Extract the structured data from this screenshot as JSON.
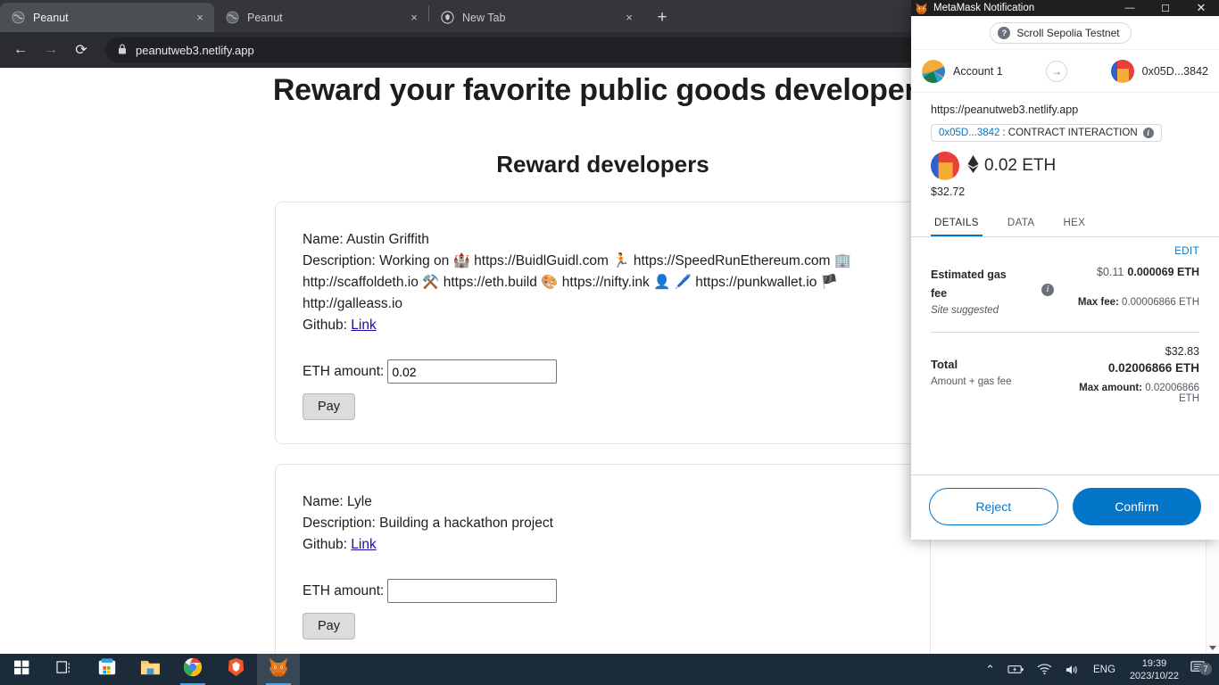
{
  "browser": {
    "tabs": [
      {
        "title": "Peanut",
        "favicon": "peanut-globe-icon",
        "active": true,
        "close_label": "×"
      },
      {
        "title": "Peanut",
        "favicon": "peanut-globe-icon",
        "active": false,
        "close_label": "×"
      },
      {
        "title": "New Tab",
        "favicon": "brave-icon",
        "active": false,
        "close_label": "×"
      }
    ],
    "new_tab_label": "+",
    "back_label": "←",
    "forward_label": "→",
    "reload_label": "⟳",
    "lock_label": "🔒",
    "url": "peanutweb3.netlify.app"
  },
  "page": {
    "heading": "Reward your favorite public goods developers",
    "subheading": "Reward developers",
    "cards": [
      {
        "name_line": "Name: Austin Griffith",
        "description_line": "Description: Working on 🏰 https://BuidlGuidl.com 🏃 https://SpeedRunEthereum.com 🏢 http://scaffoldeth.io ⚒️ https://eth.build 🎨 https://nifty.ink 👤 🖊️ https://punkwallet.io 🏴 http://galleass.io",
        "github_label": "Github:",
        "github_link_text": "Link",
        "eth_amount_label": "ETH amount:",
        "eth_amount_value": "0.02",
        "pay_label": "Pay"
      },
      {
        "name_line": "Name: Lyle",
        "description_line": "Description: Building a hackathon project",
        "github_label": "Github:",
        "github_link_text": "Link",
        "eth_amount_label": "ETH amount:",
        "eth_amount_value": "",
        "pay_label": "Pay"
      }
    ]
  },
  "metamask": {
    "window_title": "MetaMask Notification",
    "minimize_label": "—",
    "maximize_label": "☐",
    "close_label": "✕",
    "network": "Scroll Sepolia Testnet",
    "network_help_label": "?",
    "from_account": "Account 1",
    "to_account": "0x05D...3842",
    "transfer_arrow_label": "→",
    "origin": "https://peanutweb3.netlify.app",
    "contract_address": "0x05D...3842",
    "contract_action": ": CONTRACT INTERACTION",
    "contract_info_label": "i",
    "amount_eth": "0.02 ETH",
    "amount_fiat": "$32.72",
    "tabs": [
      {
        "label": "DETAILS",
        "active": true
      },
      {
        "label": "DATA",
        "active": false
      },
      {
        "label": "HEX",
        "active": false
      }
    ],
    "edit_label": "EDIT",
    "gas_title": "Estimated gas fee",
    "gas_subtitle": "Site suggested",
    "gas_info_label": "i",
    "gas_fiat": "$0.11",
    "gas_eth": "0.000069 ETH",
    "max_fee_label": "Max fee:",
    "max_fee_value": "0.00006866 ETH",
    "total_title": "Total",
    "total_subtitle": "Amount + gas fee",
    "total_fiat": "$32.83",
    "total_eth": "0.02006866 ETH",
    "max_amount_label": "Max amount:",
    "max_amount_value": "0.02006866 ETH",
    "reject_label": "Reject",
    "confirm_label": "Confirm",
    "accent_color": "#0376c9"
  },
  "taskbar": {
    "items": [
      {
        "name": "start-button",
        "icon": "windows-logo-icon"
      },
      {
        "name": "task-view-button",
        "icon": "task-view-icon"
      },
      {
        "name": "microsoft-store-button",
        "icon": "microsoft-store-icon"
      },
      {
        "name": "file-explorer-button",
        "icon": "folder-icon"
      },
      {
        "name": "chrome-button",
        "icon": "chrome-icon"
      },
      {
        "name": "brave-button",
        "icon": "brave-lion-icon"
      },
      {
        "name": "metamask-button",
        "icon": "metamask-fox-icon"
      }
    ],
    "tray": {
      "chevron_label": "⌃",
      "battery_label": "battery-icon",
      "wifi_label": "wifi-icon",
      "volume_label": "volume-icon",
      "language": "ENG",
      "time": "19:39",
      "date": "2023/10/22",
      "notification_count": "7"
    }
  }
}
